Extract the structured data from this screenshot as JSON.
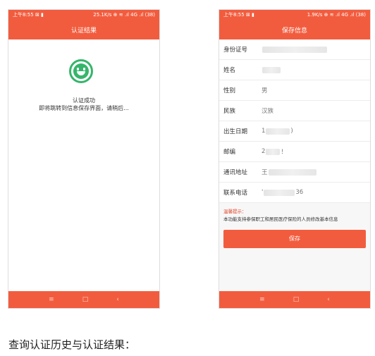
{
  "colors": {
    "brand": "#f25c3e",
    "success": "#35b56b"
  },
  "phone1": {
    "status_left": "上午8:55 ⊠ ▮",
    "status_right": "25.1K/s ⊕ ≋ .ıl 4G .ıl (38)",
    "title": "认证结果",
    "success_icon": "smile-icon",
    "message_line1": "认证成功",
    "message_line2": "即将跳转到信息保存界面，请稍后...",
    "nav": [
      "≡",
      "□",
      "‹"
    ]
  },
  "phone2": {
    "status_left": "上午8:55 ⊠ ▮",
    "status_right": "1.9K/s ⊕ ≋ .ıl 4G .ıl (38)",
    "title": "保存信息",
    "fields": [
      {
        "label": "身份证号",
        "value": ""
      },
      {
        "label": "姓名",
        "value": ""
      },
      {
        "label": "性别",
        "value": "男"
      },
      {
        "label": "民族",
        "value": "汉族"
      },
      {
        "label": "出生日期",
        "value_prefix": "1",
        "value_suffix": ")"
      },
      {
        "label": "邮编",
        "value_prefix": "2",
        "value_suffix": "！"
      },
      {
        "label": "通讯地址",
        "value_prefix": "王",
        "value_suffix": ""
      },
      {
        "label": "联系电话",
        "value_prefix": "'",
        "value_suffix": "36"
      }
    ],
    "tip_title": "温馨提示：",
    "tip_text": "本功能支持参保职工和居民医疗保险的人员修改基本信息",
    "save_label": "保存",
    "nav": [
      "≡",
      "□",
      "‹"
    ]
  },
  "caption": "查询认证历史与认证结果："
}
